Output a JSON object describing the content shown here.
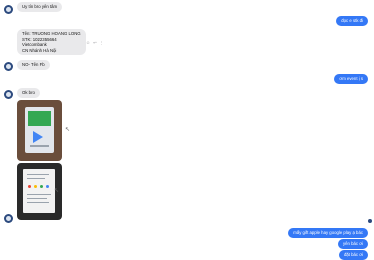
{
  "messages": {
    "m1": "Uy tín bro yên tâm",
    "m2": "đọc e stk đi",
    "m3_lines": [
      "Tên: TRUONG HOANG LONG",
      "STK: 1022355664",
      "Vietcombank",
      "CN Nhánh Hà Nội"
    ],
    "m4": "NO- Tên Fb",
    "m5": "ơm event ị s",
    "m6": "Ok bro",
    "m7": "mấy gift apple hay google play ạ bác",
    "m8": "yên bác ơi",
    "m9": "đặt bác ơi"
  },
  "actions": {
    "react": "☺",
    "reply": "↩",
    "more": "⋮"
  },
  "icons": {
    "avatar": "avatar",
    "cursor": "mouse-cursor-icon"
  },
  "colors": {
    "sent": "#3478f6",
    "received": "#e9e9eb",
    "avatar": "#2c4a7e"
  }
}
